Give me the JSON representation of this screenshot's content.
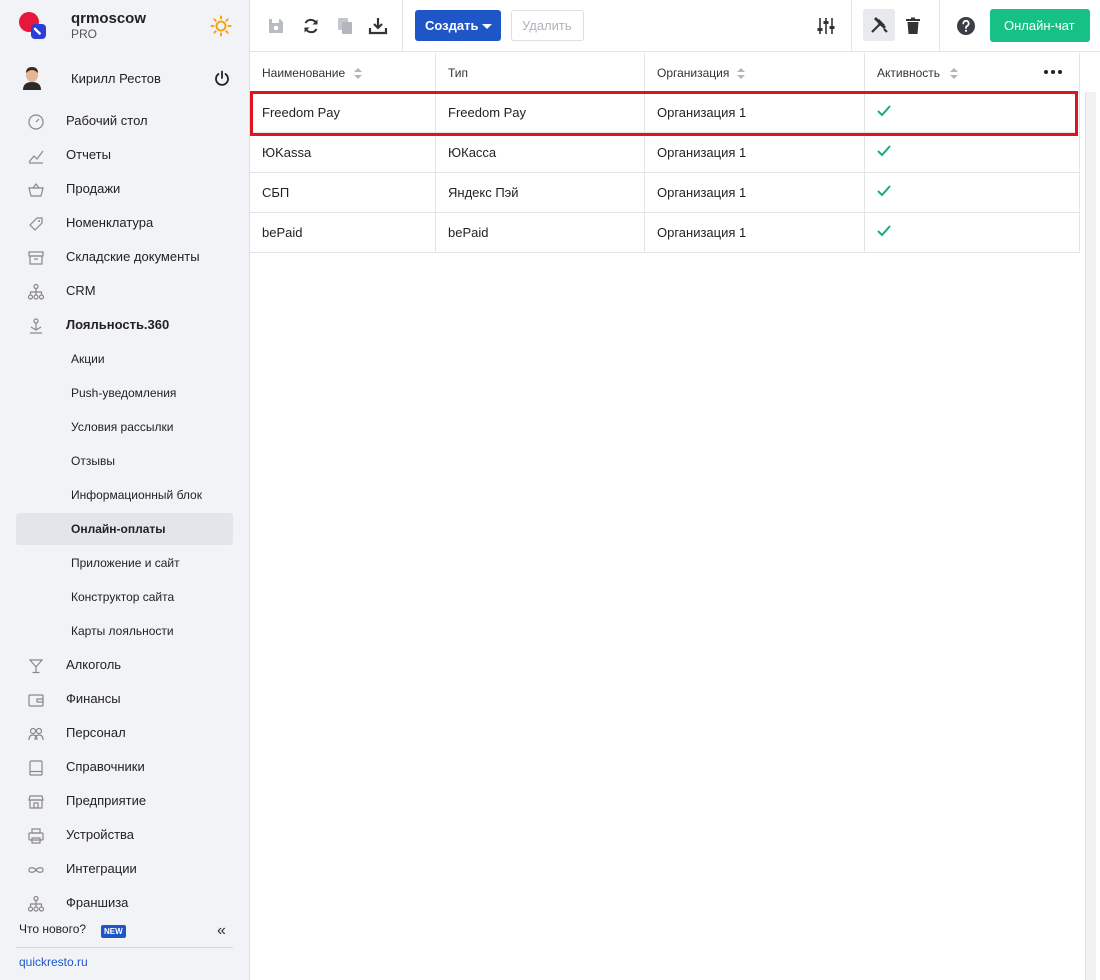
{
  "brand": {
    "name": "qrmoscow",
    "plan": "PRO"
  },
  "user": {
    "name": "Кирилл Рестов"
  },
  "nav": {
    "desktop": "Рабочий стол",
    "reports": "Отчеты",
    "sales": "Продажи",
    "nomenclature": "Номенклатура",
    "warehouse": "Складские документы",
    "crm": "CRM",
    "loyalty": "Лояльность.360",
    "sub": {
      "promos": "Акции",
      "push": "Push-уведомления",
      "mailing": "Условия рассылки",
      "reviews": "Отзывы",
      "infoblock": "Информационный блок",
      "payments": "Онлайн-оплаты",
      "app": "Приложение и сайт",
      "builder": "Конструктор сайта",
      "cards": "Карты лояльности"
    },
    "alcohol": "Алкоголь",
    "finance": "Финансы",
    "staff": "Персонал",
    "reference": "Справочники",
    "enterprise": "Предприятие",
    "devices": "Устройства",
    "integrations": "Интеграции",
    "franchise": "Франшиза"
  },
  "footer": {
    "whats_new": "Что нового?",
    "new_badge": "NEW",
    "site": "quickresto.ru"
  },
  "toolbar": {
    "create": "Создать",
    "delete": "Удалить",
    "chat": "Онлайн-чат"
  },
  "table": {
    "columns": {
      "name": "Наименование",
      "type": "Тип",
      "org": "Организация",
      "active": "Активность"
    },
    "rows": [
      {
        "name": "Freedom Pay",
        "type": "Freedom Pay",
        "org": "Организация 1",
        "active": true
      },
      {
        "name": "ЮKassa",
        "type": "ЮКасса",
        "org": "Организация 1",
        "active": true
      },
      {
        "name": "СБП",
        "type": "Яндекс Пэй",
        "org": "Организация 1",
        "active": true
      },
      {
        "name": "bePaid",
        "type": "bePaid",
        "org": "Организация 1",
        "active": true
      }
    ]
  },
  "colors": {
    "accent": "#1e56c8",
    "chat": "#17c186",
    "check": "#1dae72",
    "highlight": "#e0141e"
  }
}
